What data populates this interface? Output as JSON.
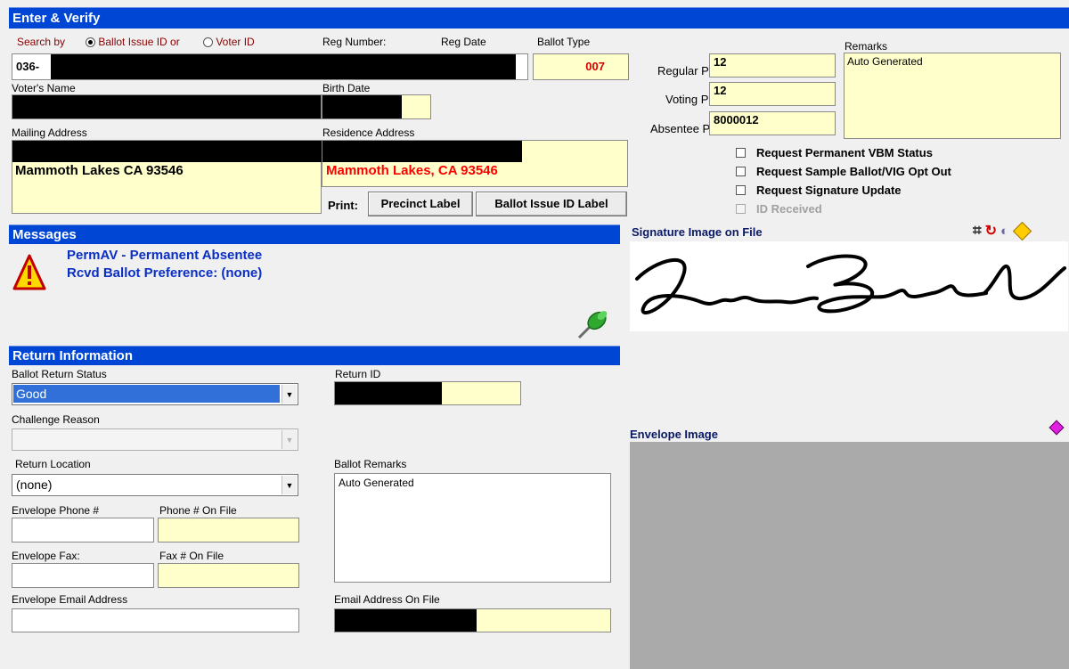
{
  "header": {
    "title": "Enter & Verify"
  },
  "search": {
    "label": "Search by",
    "option1": "Ballot Issue ID or",
    "option2": "Voter ID",
    "value": "036-"
  },
  "reg": {
    "number_label": "Reg Number:",
    "date_label": "Reg Date",
    "ballot_type_label": "Ballot Type",
    "ballot_type_value": "007"
  },
  "pct": {
    "regular_label": "Regular Pct",
    "regular_value": "12",
    "voting_label": "Voting Pct",
    "voting_value": "12",
    "absentee_label": "Absentee Pct",
    "absentee_value": "8000012"
  },
  "remarks": {
    "label": "Remarks",
    "value": "Auto Generated"
  },
  "voter": {
    "name_label": "Voter's Name",
    "birth_label": "Birth Date"
  },
  "address": {
    "mailing_label": "Mailing Address",
    "mailing_city": "Mammoth Lakes CA 93546",
    "residence_label": "Residence Address",
    "residence_city": "Mammoth Lakes, CA  93546"
  },
  "print": {
    "label": "Print:",
    "precinct_button": "Precinct Label",
    "ballot_id_button": "Ballot Issue ID Label"
  },
  "checks": {
    "permanent_vbm": "Request Permanent VBM Status",
    "sample_ballot": "Request Sample Ballot/VIG Opt Out",
    "signature_update": "Request Signature Update",
    "id_received": "ID Received"
  },
  "messages": {
    "title": "Messages",
    "line1": "PermAV - Permanent Absentee",
    "line2": "Rcvd Ballot Preference: (none)"
  },
  "signature": {
    "title": "Signature Image on File"
  },
  "return": {
    "title": "Return Information",
    "status_label": "Ballot Return Status",
    "status_value": "Good",
    "return_id_label": "Return ID",
    "challenge_label": "Challenge Reason",
    "challenge_value": "",
    "location_label": "Return Location",
    "location_value": "(none)",
    "ballot_remarks_label": "Ballot Remarks",
    "ballot_remarks_value": "Auto Generated",
    "env_phone_label": "Envelope Phone #",
    "phone_on_file_label": "Phone # On File",
    "env_fax_label": "Envelope Fax:",
    "fax_on_file_label": "Fax # On File",
    "env_email_label": "Envelope Email Address",
    "email_on_file_label": "Email Address On File"
  },
  "envelope": {
    "title": "Envelope Image"
  },
  "colors": {
    "header_blue": "#0046d5",
    "field_yellow": "#ffffcc",
    "label_red": "#8b0000",
    "message_blue": "#0a2fc4",
    "residence_red": "#ff0000"
  }
}
